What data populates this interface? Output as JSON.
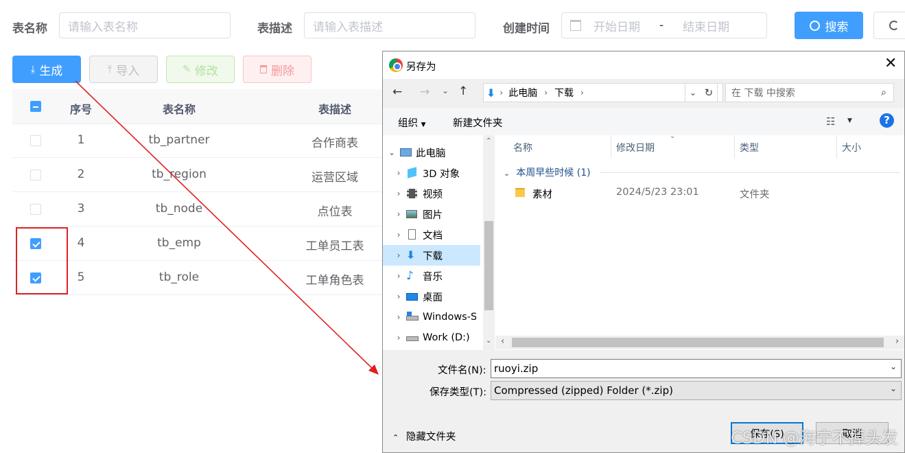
{
  "filters": {
    "table_name_label": "表名称",
    "table_name_placeholder": "请输入表名称",
    "table_desc_label": "表描述",
    "table_desc_placeholder": "请输入表描述",
    "created_label": "创建时间",
    "start_date_placeholder": "开始日期",
    "date_separator": "-",
    "end_date_placeholder": "结束日期",
    "search_button": "搜索"
  },
  "toolbar": {
    "generate": "生成",
    "import": "导入",
    "edit": "修改",
    "delete": "删除"
  },
  "table": {
    "headers": [
      "序号",
      "表名称",
      "表描述"
    ],
    "rows": [
      {
        "index": "1",
        "name": "tb_partner",
        "desc": "合作商表",
        "checked": false
      },
      {
        "index": "2",
        "name": "tb_region",
        "desc": "运营区域",
        "checked": false
      },
      {
        "index": "3",
        "name": "tb_node",
        "desc": "点位表",
        "checked": false
      },
      {
        "index": "4",
        "name": "tb_emp",
        "desc": "工单员工表",
        "checked": true
      },
      {
        "index": "5",
        "name": "tb_role",
        "desc": "工单角色表",
        "checked": true
      }
    ]
  },
  "dialog": {
    "title": "另存为",
    "breadcrumb": [
      "此电脑",
      "下载"
    ],
    "search_placeholder": "在 下载 中搜索",
    "organize": "组织",
    "new_folder": "新建文件夹",
    "help": "?",
    "tree": [
      {
        "label": "此电脑",
        "icon": "pc-icon",
        "expanded": true
      },
      {
        "label": "3D 对象",
        "icon": "cube-icon"
      },
      {
        "label": "视频",
        "icon": "video-icon"
      },
      {
        "label": "图片",
        "icon": "picture-icon"
      },
      {
        "label": "文档",
        "icon": "document-icon"
      },
      {
        "label": "下载",
        "icon": "download-icon",
        "selected": true
      },
      {
        "label": "音乐",
        "icon": "music-icon"
      },
      {
        "label": "桌面",
        "icon": "desktop-icon"
      },
      {
        "label": "Windows-S",
        "icon": "drive-icon"
      },
      {
        "label": "Work (D:)",
        "icon": "drive-icon"
      }
    ],
    "columns": [
      "名称",
      "修改日期",
      "类型",
      "大小"
    ],
    "group_label": "本周早些时候 (1)",
    "files": [
      {
        "name": "素材",
        "modified": "2024/5/23 23:01",
        "type": "文件夹"
      }
    ],
    "filename_label": "文件名(N):",
    "filename_value": "ruoyi.zip",
    "filetype_label": "保存类型(T):",
    "filetype_value": "Compressed (zipped) Folder (*.zip)",
    "hide_folders": "隐藏文件夹",
    "save_button": "保存(S)",
    "cancel_button": "取消"
  },
  "watermark": "CSDN @海宁不掉头发",
  "colors": {
    "primary": "#409eff",
    "annotation_red": "#e02020",
    "selection_blue": "#cce8ff"
  }
}
